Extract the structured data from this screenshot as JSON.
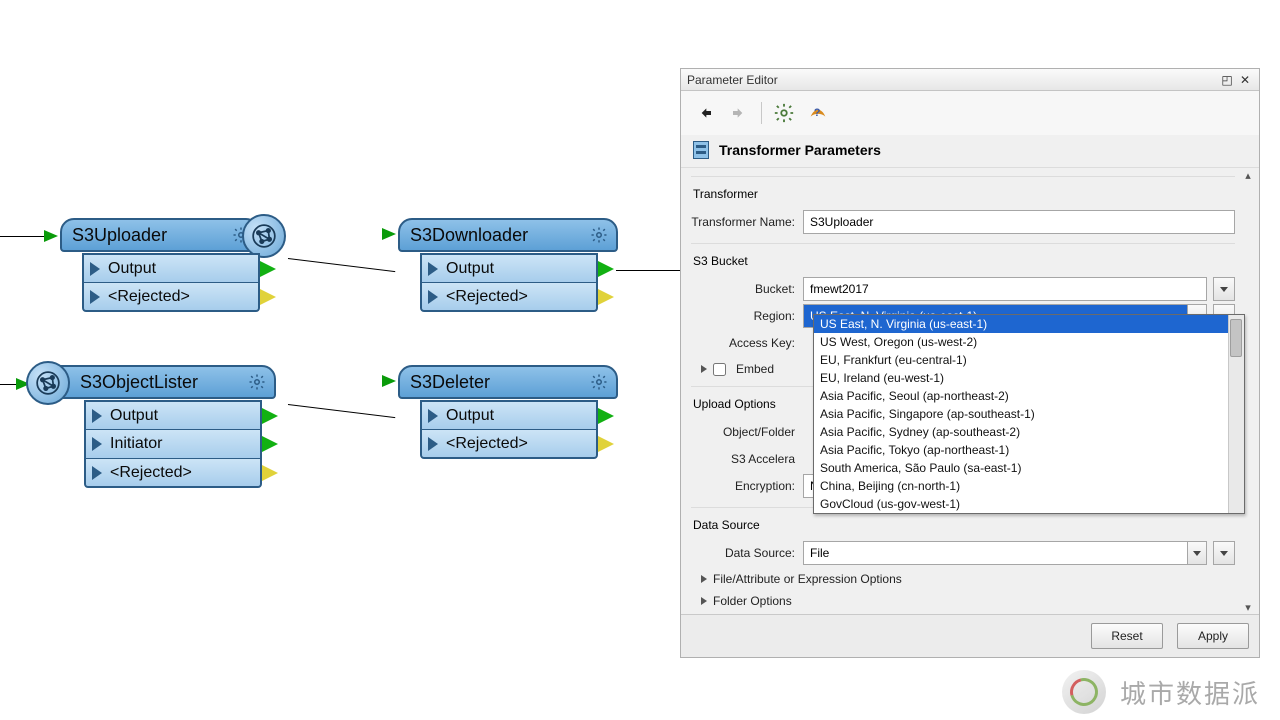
{
  "nodes": {
    "uploader": {
      "title": "S3Uploader",
      "ports": [
        "Output",
        "<Rejected>"
      ]
    },
    "downloader": {
      "title": "S3Downloader",
      "ports": [
        "Output",
        "<Rejected>"
      ]
    },
    "objectlister": {
      "title": "S3ObjectLister",
      "ports": [
        "Output",
        "Initiator",
        "<Rejected>"
      ]
    },
    "deleter": {
      "title": "S3Deleter",
      "ports": [
        "Output",
        "<Rejected>"
      ]
    }
  },
  "panel": {
    "title": "Parameter Editor",
    "section_title": "Transformer Parameters",
    "groups": {
      "transformer_label": "Transformer",
      "transformer_name_label": "Transformer Name:",
      "transformer_name_value": "S3Uploader",
      "s3_bucket_label": "S3 Bucket",
      "bucket_label": "Bucket:",
      "bucket_value": "fmewt2017",
      "region_label": "Region:",
      "region_value": "US East, N. Virginia (us-east-1)",
      "access_key_label": "Access Key:",
      "embed_label": "Embed",
      "upload_options_label": "Upload Options",
      "object_folder_label": "Object/Folder",
      "s3_accel_label": "S3 Accelera",
      "encryption_label": "Encryption:",
      "encryption_value": "None",
      "data_source_group": "Data Source",
      "data_source_label": "Data Source:",
      "data_source_value": "File",
      "expander_file_attr": "File/Attribute or Expression Options",
      "expander_folder": "Folder Options"
    },
    "region_options": [
      "US East, N. Virginia (us-east-1)",
      "US West, Oregon (us-west-2)",
      "EU, Frankfurt (eu-central-1)",
      "EU, Ireland (eu-west-1)",
      "Asia Pacific, Seoul (ap-northeast-2)",
      "Asia Pacific, Singapore (ap-southeast-1)",
      "Asia Pacific, Sydney (ap-southeast-2)",
      "Asia Pacific, Tokyo (ap-northeast-1)",
      "South America, São Paulo (sa-east-1)",
      "China, Beijing (cn-north-1)",
      "GovCloud (us-gov-west-1)"
    ],
    "footer": {
      "reset": "Reset",
      "apply": "Apply"
    }
  },
  "watermark_text": "城市数据派"
}
